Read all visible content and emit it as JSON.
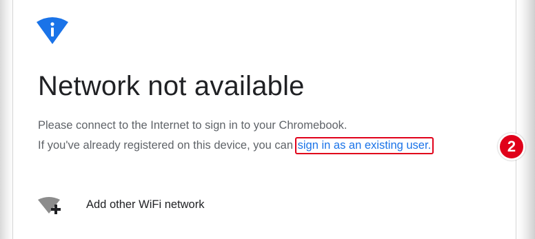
{
  "screen": {
    "title": "Network not available",
    "message_line1": "Please connect to the Internet to sign in to your Chromebook.",
    "message_line2_prefix": "If you've already registered on this device, you can ",
    "existing_user_link": "sign in as an existing user.",
    "annotation_badge": "2"
  },
  "network_list": {
    "add_wifi_label": "Add other WiFi network"
  },
  "icons": {
    "info": "info-icon",
    "wifi_add": "wifi-add-icon"
  },
  "colors": {
    "accent": "#1a73e8",
    "highlight": "#e0001a",
    "text_primary": "#202124",
    "text_secondary": "#5f6368"
  }
}
